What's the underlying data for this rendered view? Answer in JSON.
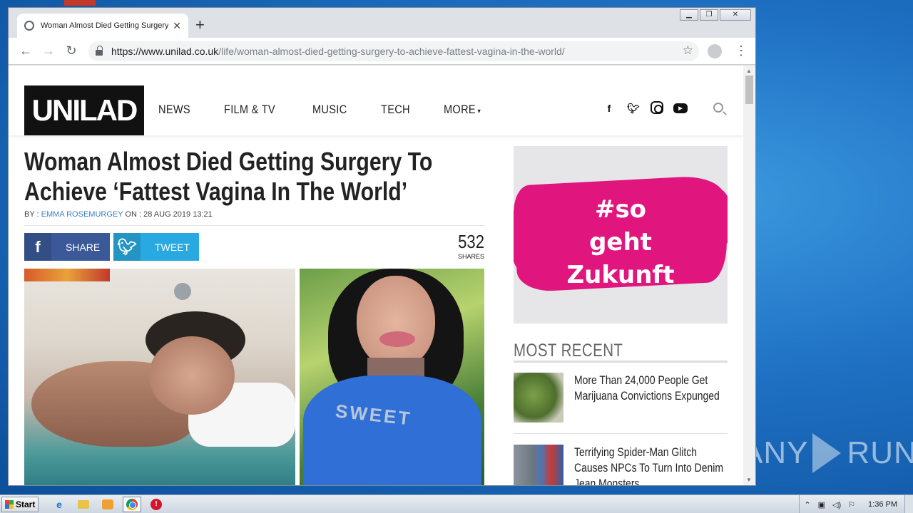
{
  "browser": {
    "tab_title": "Woman Almost Died Getting Surgery To Achieve 'Fattest Vagina In The World'",
    "new_tab": "+",
    "tab_close": "✕",
    "url_host": "https://www.unilad.co.uk",
    "url_path": "/life/woman-almost-died-getting-surgery-to-achieve-fattest-vagina-in-the-world/",
    "back": "←",
    "forward": "→",
    "reload": "↻",
    "star": "☆",
    "menu": "⋮",
    "window_controls": {
      "minimize": "▁",
      "restore": "❐",
      "close": "✕"
    }
  },
  "site": {
    "logo": "UNILAD",
    "nav": [
      "NEWS",
      "FILM & TV",
      "MUSIC",
      "TECH",
      "MORE"
    ],
    "social_icons": [
      "facebook-icon",
      "twitter-icon",
      "instagram-icon",
      "youtube-icon"
    ]
  },
  "article": {
    "headline": "Woman Almost Died Getting Surgery To Achieve ‘Fattest Vagina In The World’",
    "by_label": "BY : ",
    "author": "EMMA ROSEMURGEY",
    "date_label": " ON : 28 AUG 2019 13:21",
    "share_facebook": "SHARE",
    "share_twitter": "TWEET",
    "share_count": "532",
    "share_count_label": "SHARES",
    "hero_shirt_text": "SWEET"
  },
  "sidebar": {
    "ad_text": [
      "#so",
      "geht",
      "Zukunft"
    ],
    "most_recent_title": "MOST RECENT",
    "items": [
      {
        "title": "More Than 24,000 People Get Marijuana Convictions Expunged"
      },
      {
        "title": "Terrifying Spider-Man Glitch Causes NPCs To Turn Into Denim Jean Monsters"
      }
    ]
  },
  "taskbar": {
    "start": "Start",
    "clock": "1:36 PM"
  },
  "watermark": "ANY RUN",
  "colors": {
    "facebook": "#3b5998",
    "twitter": "#29a9e1",
    "author_link": "#3b7fc4",
    "ad_pink": "#e0157e"
  }
}
